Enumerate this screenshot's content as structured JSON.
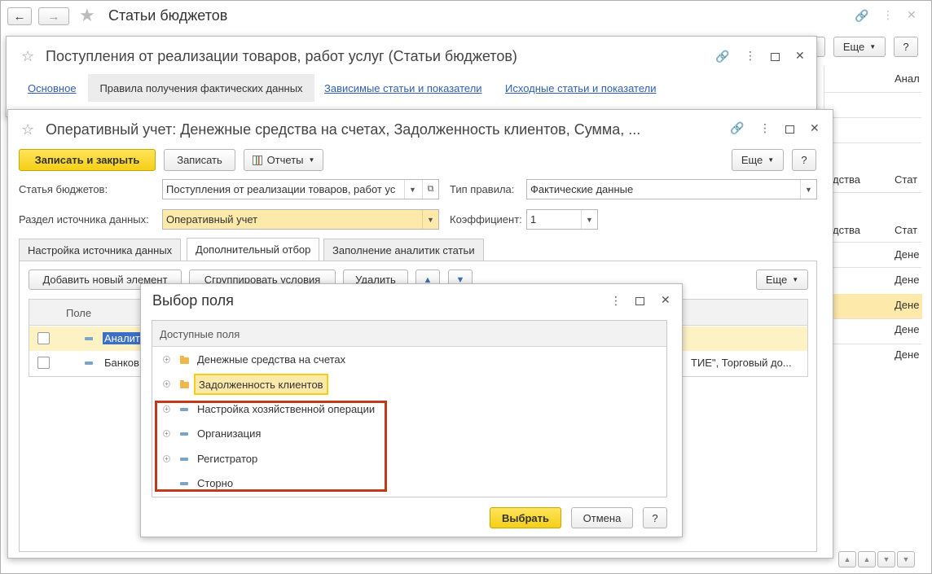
{
  "main": {
    "title": "Статьи бюджетов",
    "more_label": "Еще",
    "help_label": "?",
    "right_cells": [
      "Анал",
      "дства",
      "Стат",
      "дства",
      "Стат",
      "Дене",
      "Дене",
      "Дене",
      "Дене",
      "Дене"
    ]
  },
  "second": {
    "title": "Поступления от реализации товаров, работ услуг (Статьи бюджетов)",
    "tabs": [
      "Основное",
      "Правила получения фактических данных",
      "Зависимые статьи и показатели",
      "Исходные статьи и показатели"
    ]
  },
  "third": {
    "title": "Оперативный учет: Денежные средства на счетах, Задолженность клиентов, Сумма, ...",
    "save_close": "Записать и закрыть",
    "save": "Записать",
    "reports": "Отчеты",
    "more": "Еще",
    "help": "?",
    "budget_item_label": "Статья бюджетов:",
    "budget_item_value": "Поступления от реализации товаров, работ ус",
    "rule_type_label": "Тип правила:",
    "rule_type_value": "Фактические данные",
    "source_label": "Раздел источника данных:",
    "source_value": "Оперативный учет",
    "coef_label": "Коэффициент:",
    "coef_value": "1",
    "tabs": [
      "Настройка источника данных",
      "Дополнительный отбор",
      "Заполнение аналитик статьи"
    ],
    "add_btn": "Добавить новый элемент",
    "group_btn": "Сгруппировать условия",
    "delete_btn": "Удалить",
    "more2": "Еще",
    "table_header": "Поле",
    "rows": [
      {
        "field": "Аналит",
        "tail": ""
      },
      {
        "field": "Банков",
        "tail": "ТИЕ\", Торговый до..."
      }
    ]
  },
  "dialog": {
    "title": "Выбор поля",
    "header": "Доступные поля",
    "items": [
      {
        "label": "Денежные средства на счетах",
        "type": "folder",
        "expander": true
      },
      {
        "label": "Задолженность клиентов",
        "type": "folder",
        "expander": true
      },
      {
        "label": "Настройка хозяйственной операции",
        "type": "field",
        "expander": true
      },
      {
        "label": "Организация",
        "type": "field",
        "expander": true
      },
      {
        "label": "Регистратор",
        "type": "field",
        "expander": true
      },
      {
        "label": "Сторно",
        "type": "field",
        "expander": false
      }
    ],
    "select_btn": "Выбрать",
    "cancel_btn": "Отмена",
    "help_btn": "?"
  },
  "colors": {
    "accent_yellow": "#f5cf16",
    "selection_yellow": "#fde9a9",
    "highlight_box": "#c0391b",
    "link_blue": "#2f5fb3"
  }
}
